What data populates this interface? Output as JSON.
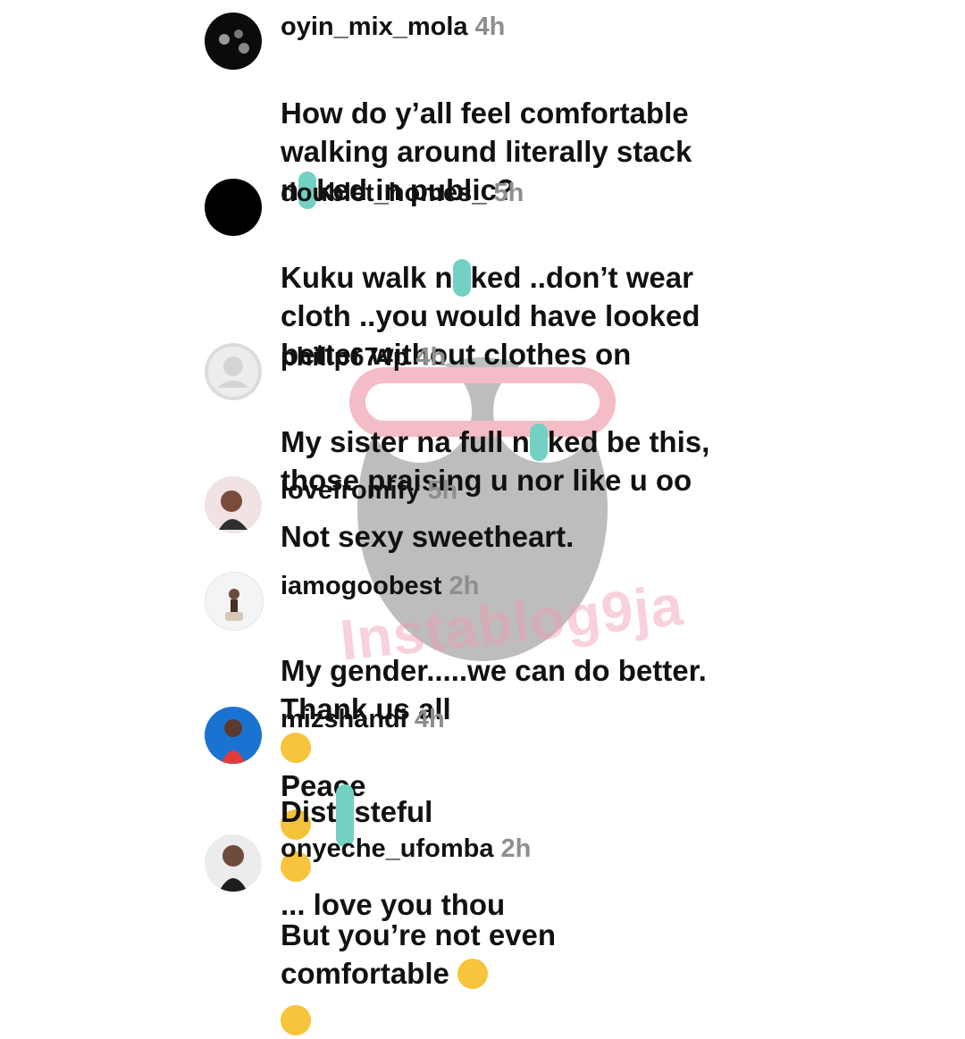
{
  "comments": [
    {
      "username": "oyin_mix_mola",
      "time": "4h",
      "text_parts": [
        "How do y’all feel comfortable\nwalking around literally stack\nn",
        "ked in public?"
      ]
    },
    {
      "username": "doublet_homes_",
      "time": "5h",
      "text_parts": [
        "Kuku walk n",
        "ked ..don’t wear\ncloth ..you would have looked\nbetter without clothes on"
      ]
    },
    {
      "username": "philip674p",
      "time": "4h",
      "text_parts": [
        "My sister na full n",
        "ked be this,\nthose praising u nor like u oo"
      ]
    },
    {
      "username": "lovefromify",
      "time": "5h",
      "text": "Not sexy sweetheart."
    },
    {
      "username": "iamogoobest",
      "time": "2h",
      "text_parts": [
        "My gender.....we can do better.\nThank us all ",
        " Peace"
      ]
    },
    {
      "username": "mizshandi",
      "time": "4h",
      "text_parts": [
        "Dist",
        "steful",
        "... love you thou"
      ]
    },
    {
      "username": "onyeche_ufomba",
      "time": "2h",
      "text_parts": [
        "But you’re not even\ncomfortable "
      ]
    }
  ],
  "watermark": "Instablog9ja",
  "colors": {
    "timestamp": "#8e8e8e",
    "censor": "#72d1c2",
    "watermark": "#f29bb0"
  }
}
